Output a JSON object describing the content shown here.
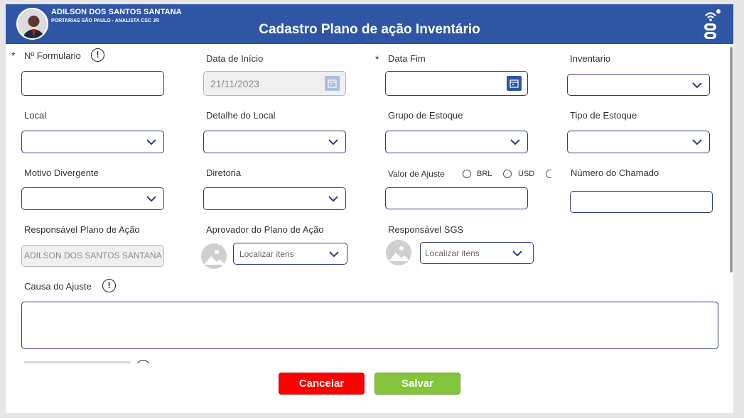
{
  "header": {
    "user_name": "ADILSON DOS SANTOS SANTANA",
    "user_role": "PORTARIAS SÃO PAULO - ANALISTA CSC JR",
    "title": "Cadastro Plano de ação Inventário",
    "logo_icon": "wifi-logo-icon",
    "bg_color": "#2f56a5"
  },
  "form": {
    "required_mark": "*",
    "info_mark": "!",
    "numero_formulario": {
      "label": "Nº Formulario",
      "value": ""
    },
    "data_inicio": {
      "label": "Data de Início",
      "value": "21/11/2023"
    },
    "data_fim": {
      "label": "Data Fim",
      "value": ""
    },
    "inventario": {
      "label": "Inventario",
      "value": ""
    },
    "local": {
      "label": "Local",
      "value": ""
    },
    "detalhe_local": {
      "label": "Detalhe do Local",
      "value": ""
    },
    "grupo_estoque": {
      "label": "Grupo de Estoque",
      "value": ""
    },
    "tipo_estoque": {
      "label": "Tipo de Estoque",
      "value": ""
    },
    "motivo_divergente": {
      "label": "Motivo Divergente",
      "value": ""
    },
    "diretoria": {
      "label": "Diretoria",
      "value": ""
    },
    "valor_ajuste": {
      "label": "Valor de Ajuste",
      "value": "",
      "currencies": [
        "BRL",
        "USD"
      ]
    },
    "numero_chamado": {
      "label": "Número do Chamado",
      "value": ""
    },
    "responsavel_plano": {
      "label": "Responsável Plano de Ação",
      "value": "ADILSON DOS SANTOS SANTANA"
    },
    "aprovador_plano": {
      "label": "Aprovador do Plano de Ação",
      "placeholder": "Localizar itens"
    },
    "responsavel_sgs": {
      "label": "Responsável SGS",
      "placeholder": "Localizar itens"
    },
    "causa_ajuste": {
      "label": "Causa do Ajuste",
      "value": ""
    }
  },
  "actions": {
    "cancel_label": "Cancelar",
    "save_label": "Salvar",
    "cancel_color": "#ff0000",
    "save_color": "#84c33c"
  }
}
